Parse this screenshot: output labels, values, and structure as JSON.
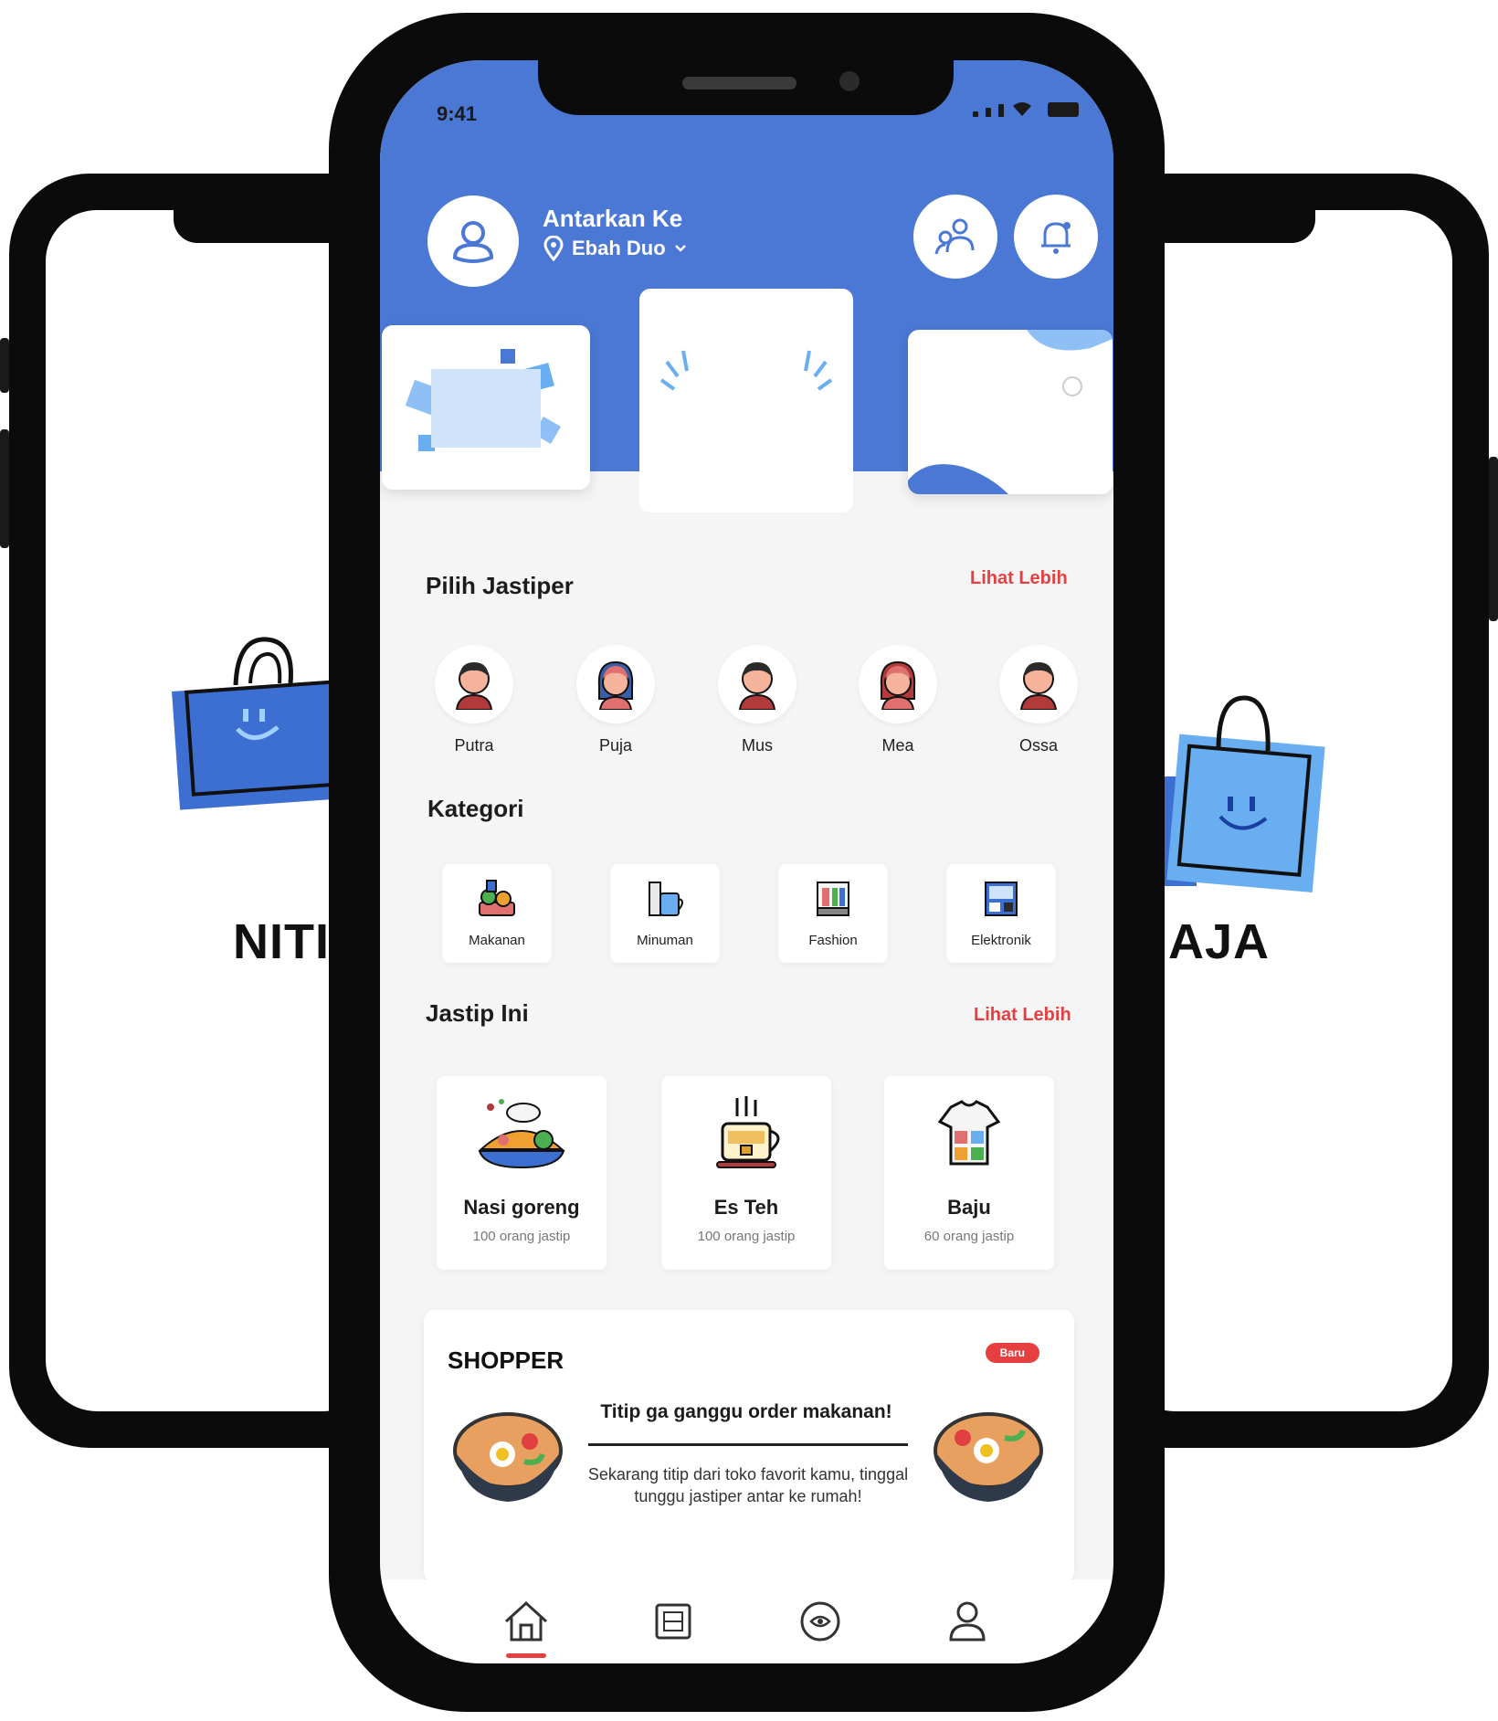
{
  "background": {
    "left_slogan": "NITIP",
    "right_slogan": "P AJA"
  },
  "status_bar": {
    "time": "9:41"
  },
  "header": {
    "user_name": "Antarkan Ke",
    "location": "Ebah Duo",
    "accent_color": "#4a78d4"
  },
  "banners": [
    {
      "small": "",
      "text": ""
    },
    {
      "small": "",
      "text": ""
    },
    {
      "small": "",
      "text": ""
    }
  ],
  "jastiper_section": {
    "title": "Pilih Jastiper",
    "see_more": "Lihat Lebih",
    "items": [
      {
        "name": "Putra",
        "type": "male"
      },
      {
        "name": "Puja",
        "type": "female"
      },
      {
        "name": "Mus",
        "type": "male"
      },
      {
        "name": "Mea",
        "type": "female"
      },
      {
        "name": "Ossa",
        "type": "male"
      }
    ]
  },
  "category_section": {
    "title": "Kategori",
    "items": [
      {
        "label": "Makanan",
        "icon": "food-icon"
      },
      {
        "label": "Minuman",
        "icon": "drink-icon"
      },
      {
        "label": "Fashion",
        "icon": "fashion-icon"
      },
      {
        "label": "Elektronik",
        "icon": "electronics-icon"
      }
    ]
  },
  "jastip_section": {
    "title": "Jastip Ini",
    "see_more": "Lihat Lebih",
    "items": [
      {
        "name": "Nasi goreng",
        "sub": "100 orang jastip",
        "icon": "fried-rice-icon"
      },
      {
        "name": "Es Teh",
        "sub": "100 orang jastip",
        "icon": "tea-icon"
      },
      {
        "name": "Baju",
        "sub": "60 orang jastip",
        "icon": "shirt-icon"
      }
    ]
  },
  "shopper_card": {
    "title": "SHOPPER",
    "badge": "Baru",
    "headline": "Titip ga ganggu order makanan!",
    "body": "Sekarang titip dari toko favorit kamu, tinggal tunggu jastiper antar ke rumah!"
  },
  "bottom_nav": [
    {
      "name": "home",
      "active": true
    },
    {
      "name": "orders",
      "active": false
    },
    {
      "name": "chat",
      "active": false
    },
    {
      "name": "profile",
      "active": false
    }
  ],
  "colors": {
    "brand_blue": "#4a78d4",
    "accent_red": "#e5403f"
  }
}
